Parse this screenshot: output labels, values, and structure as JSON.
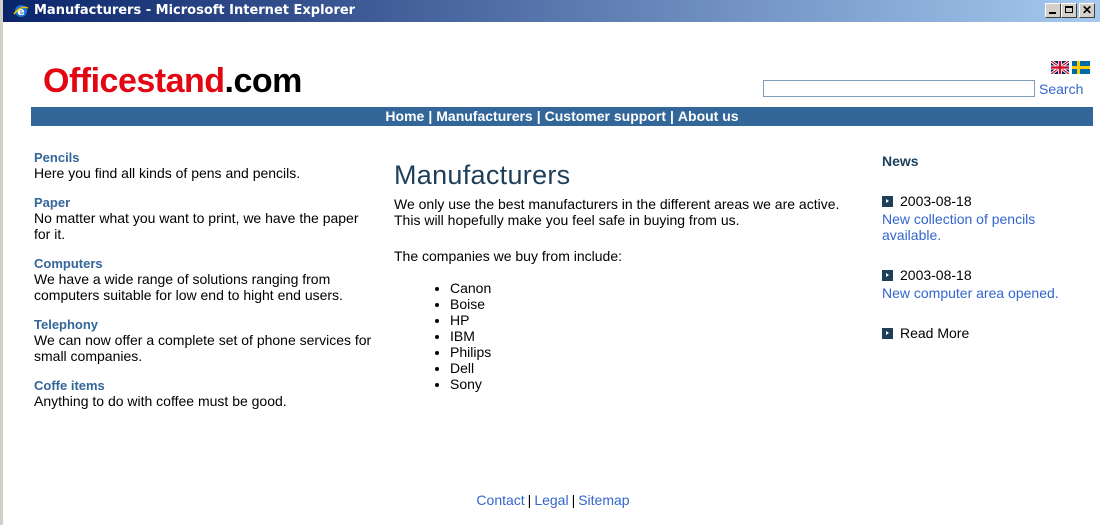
{
  "window": {
    "title": "Manufacturers - Microsoft Internet Explorer",
    "min_icon": "minimize-icon",
    "max_icon": "maximize-icon",
    "close_icon": "close-icon"
  },
  "header": {
    "logo_brand": "Officestand",
    "logo_tld": ".com",
    "search_placeholder": "",
    "search_value": "",
    "search_label": "Search",
    "languages": [
      "en-flag-icon",
      "se-flag-icon"
    ]
  },
  "nav": {
    "items": [
      "Home",
      "Manufacturers",
      "Customer support",
      "About us"
    ],
    "separator": "|"
  },
  "categories": [
    {
      "title": "Pencils",
      "desc": "Here you find all kinds of pens and pencils."
    },
    {
      "title": "Paper",
      "desc": "No matter what you want to print, we have the paper for it."
    },
    {
      "title": "Computers",
      "desc": "We have a wide range of solutions ranging from computers suitable for low end to hight end users."
    },
    {
      "title": "Telephony",
      "desc": "We can now offer a complete set of phone services for small companies."
    },
    {
      "title": "Coffe items",
      "desc": "Anything to do with coffee must be good."
    }
  ],
  "main": {
    "heading": "Manufacturers",
    "intro": "We only use the best manufacturers in the different areas we are active. This will hopefully make you feel safe in buying from us.",
    "companies_label": "The companies we buy from include:",
    "companies": [
      "Canon",
      "Boise",
      "HP",
      "IBM",
      "Philips",
      "Dell",
      "Sony"
    ]
  },
  "news": {
    "title": "News",
    "items": [
      {
        "date": "2003-08-18",
        "headline": "New collection of pencils available."
      },
      {
        "date": "2003-08-18",
        "headline": "New computer area opened."
      }
    ],
    "read_more": "Read More"
  },
  "footer": {
    "links": [
      "Contact",
      "Legal",
      "Sitemap"
    ],
    "separator": "|"
  },
  "colors": {
    "brand_red": "#e30613",
    "nav_blue": "#336699",
    "link_blue": "#3366cc",
    "heading_dark": "#1e3f5a"
  }
}
